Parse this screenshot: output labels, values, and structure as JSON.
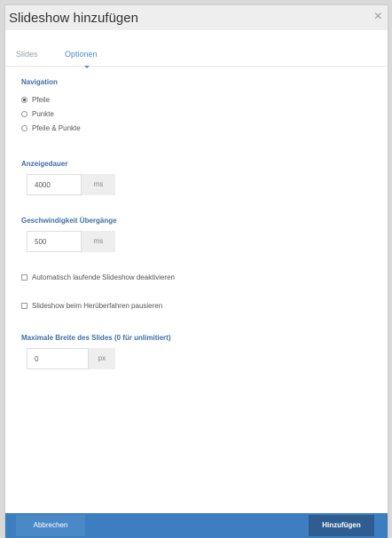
{
  "dialog": {
    "title": "Slideshow hinzufügen",
    "close_glyph": "×",
    "close_icon": "close-icon"
  },
  "tabs": [
    {
      "label": "Slides"
    },
    {
      "label": "Optionen"
    }
  ],
  "navigation": {
    "heading": "Navigation",
    "options": [
      {
        "label": "Pfeile",
        "checked": true
      },
      {
        "label": "Punkte",
        "checked": false
      },
      {
        "label": "Pfeile & Punkte",
        "checked": false
      }
    ]
  },
  "display_duration": {
    "heading": "Anzeigedauer",
    "value": "4000",
    "unit": "ms"
  },
  "transition_speed": {
    "heading": "Geschwindigkeit Übergänge",
    "value": "500",
    "unit": "ms"
  },
  "checkboxes": [
    {
      "label": "Automatisch laufende Slideshow deaktivieren",
      "checked": false
    },
    {
      "label": "Slideshow beim Herüberfahren pausieren",
      "checked": false
    }
  ],
  "max_width": {
    "heading": "Maximale Breite des Slides (0 für unlimitiert)",
    "value": "0",
    "unit": "px"
  },
  "footer": {
    "cancel_label": "Abbrechen",
    "submit_label": "Hinzufügen"
  },
  "colors": {
    "accent": "#4a8ad6",
    "heading": "#3f6fa6",
    "footer": "#3d7ec0",
    "primary_button": "#2f5d8f"
  }
}
